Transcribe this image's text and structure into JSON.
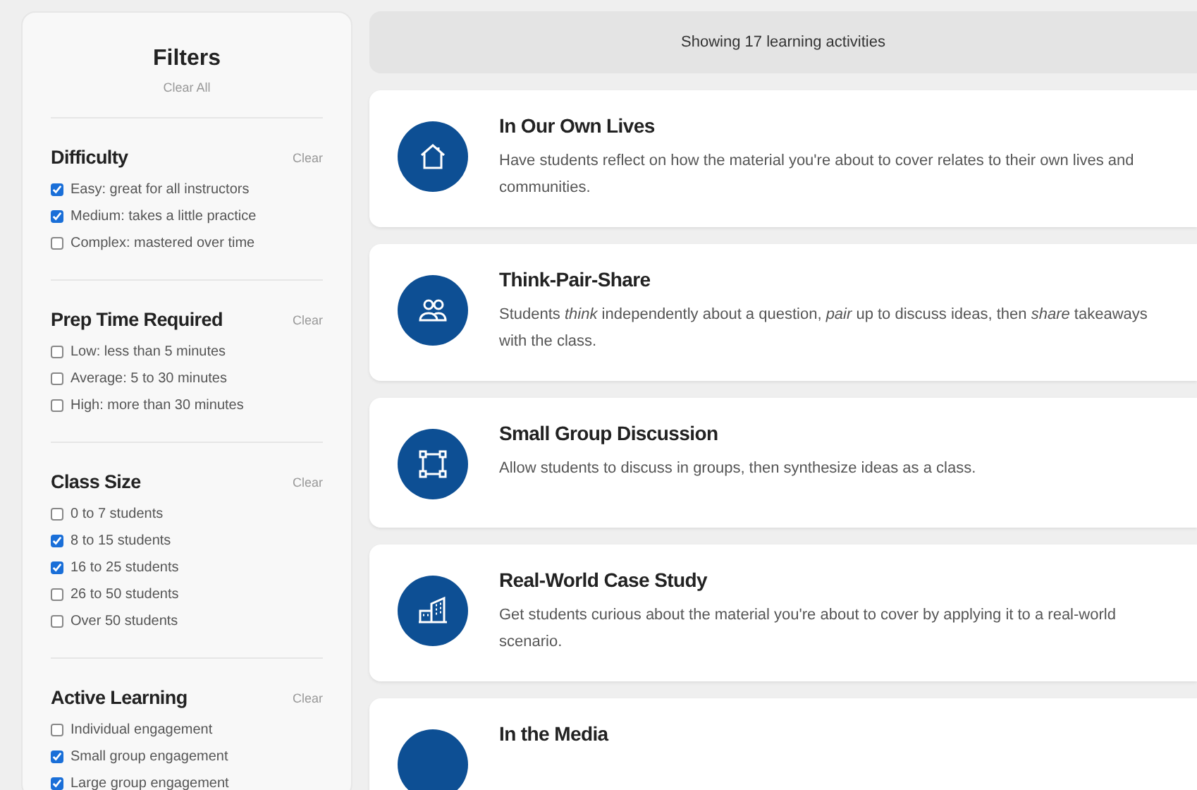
{
  "filters": {
    "title": "Filters",
    "clear_all": "Clear All",
    "groups": [
      {
        "title": "Difficulty",
        "clear": "Clear",
        "options": [
          {
            "label": "Easy: great for all instructors",
            "checked": true
          },
          {
            "label": "Medium: takes a little practice",
            "checked": true
          },
          {
            "label": "Complex: mastered over time",
            "checked": false
          }
        ]
      },
      {
        "title": "Prep Time Required",
        "clear": "Clear",
        "options": [
          {
            "label": "Low: less than 5 minutes",
            "checked": false
          },
          {
            "label": "Average: 5 to 30 minutes",
            "checked": false
          },
          {
            "label": "High: more than 30 minutes",
            "checked": false
          }
        ]
      },
      {
        "title": "Class Size",
        "clear": "Clear",
        "options": [
          {
            "label": "0 to 7 students",
            "checked": false
          },
          {
            "label": "8 to 15 students",
            "checked": true
          },
          {
            "label": "16 to 25 students",
            "checked": true
          },
          {
            "label": "26 to 50 students",
            "checked": false
          },
          {
            "label": "Over 50 students",
            "checked": false
          }
        ]
      },
      {
        "title": "Active Learning",
        "clear": "Clear",
        "options": [
          {
            "label": "Individual engagement",
            "checked": false
          },
          {
            "label": "Small group engagement",
            "checked": true
          },
          {
            "label": "Large group engagement",
            "checked": true
          }
        ]
      }
    ]
  },
  "results_header": "Showing 17 learning activities",
  "activities": [
    {
      "kind": "home",
      "title": "In Our Own Lives",
      "description": "Have students reflect on how the material you're about to cover relates to their own lives and communities."
    },
    {
      "kind": "people",
      "title": "Think-Pair-Share",
      "description": "Students *think* independently about a question, *pair* up to discuss ideas, then *share* takeaways with the class."
    },
    {
      "kind": "nodes",
      "title": "Small Group Discussion",
      "description": "Allow students to discuss in groups, then synthesize ideas as a class."
    },
    {
      "kind": "building",
      "title": "Real-World Case Study",
      "description": "Get students curious about the material you're about to cover by applying it to a real-world scenario."
    },
    {
      "title": "In the Media"
    }
  ]
}
